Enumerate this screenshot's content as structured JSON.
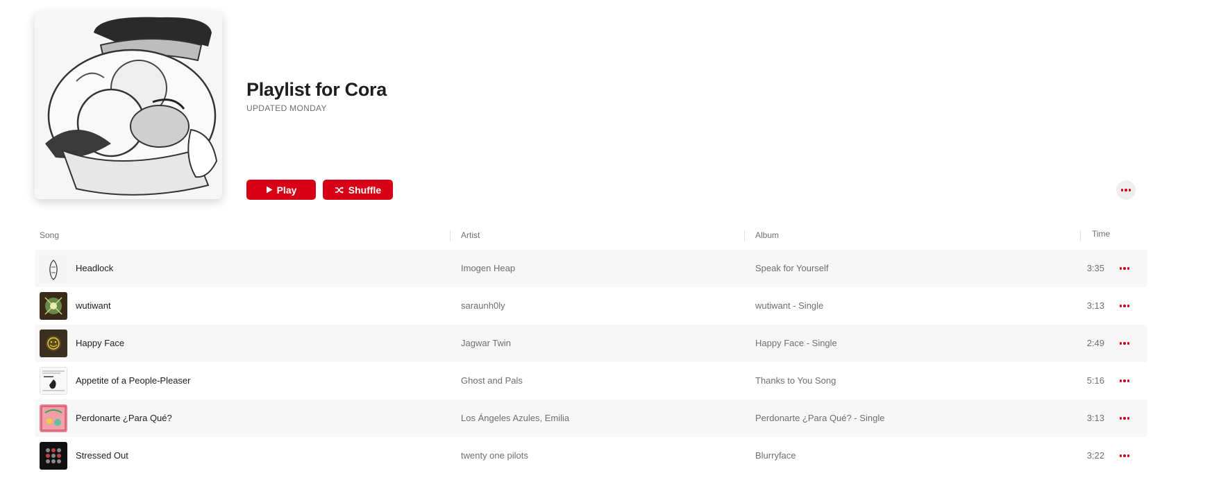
{
  "playlist": {
    "title": "Playlist for Cora",
    "subtitle": "UPDATED MONDAY",
    "play_label": "Play",
    "shuffle_label": "Shuffle"
  },
  "columns": {
    "song": "Song",
    "artist": "Artist",
    "album": "Album",
    "time": "Time"
  },
  "tracks": [
    {
      "song": "Headlock",
      "artist": "Imogen Heap",
      "album": "Speak for Yourself",
      "time": "3:35"
    },
    {
      "song": "wutiwant",
      "artist": "saraunh0ly",
      "album": "wutiwant - Single",
      "time": "3:13"
    },
    {
      "song": "Happy Face",
      "artist": "Jagwar Twin",
      "album": "Happy Face - Single",
      "time": "2:49"
    },
    {
      "song": "Appetite of a People-Pleaser",
      "artist": "Ghost and Pals",
      "album": "Thanks to You Song",
      "time": "5:16"
    },
    {
      "song": "Perdonarte ¿Para Qué?",
      "artist": "Los Ángeles Azules, Emilia",
      "album": "Perdonarte ¿Para Qué? - Single",
      "time": "3:13"
    },
    {
      "song": "Stressed Out",
      "artist": "twenty one pilots",
      "album": "Blurryface",
      "time": "3:22"
    }
  ],
  "icons": {
    "play": "play-icon",
    "shuffle": "shuffle-icon",
    "more": "more-icon"
  },
  "colors": {
    "accent": "#d60017",
    "secondary_text": "#6e6e73",
    "row_alt": "#f7f7f7"
  }
}
